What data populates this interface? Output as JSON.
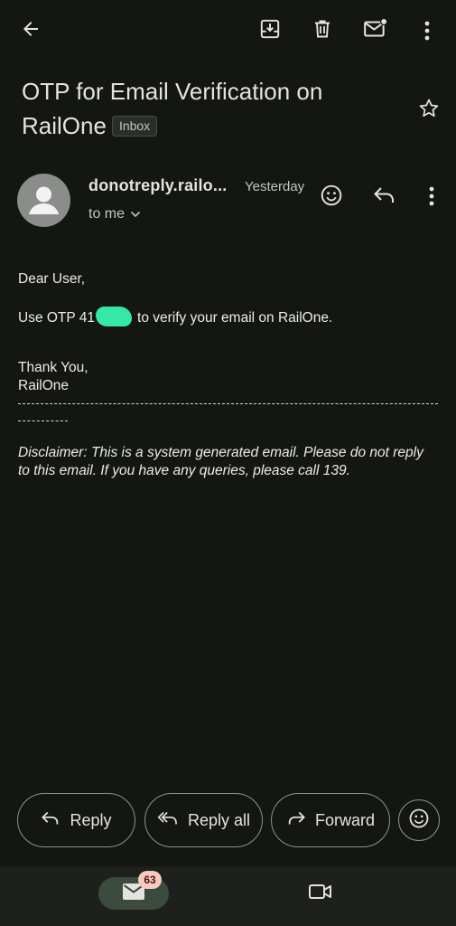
{
  "header": {
    "subject": "OTP for Email Verification on RailOne",
    "label": "Inbox"
  },
  "message": {
    "sender": "donotreply.railo...",
    "time": "Yesterday",
    "recipient": "to me"
  },
  "body": {
    "greeting": "Dear User,",
    "otp_prefix": "Use OTP 41",
    "otp_suffix": "to verify your email on RailOne.",
    "thanks": "Thank You,",
    "signature": "RailOne",
    "disclaimer": "Disclaimer: This is a system generated email. Please do not reply to this email. If you have any queries, please call 139."
  },
  "actions": {
    "reply_label": "Reply",
    "reply_all_label": "Reply all",
    "forward_label": "Forward"
  },
  "bottom_nav": {
    "mail_badge": "63"
  },
  "icons": {
    "top_bar": [
      "back-arrow-icon",
      "archive-icon",
      "delete-icon",
      "mark-unread-icon",
      "more-vert-icon"
    ],
    "star": "star-icon",
    "message_actions": [
      "emoji-icon",
      "reply-icon",
      "more-vert-icon"
    ],
    "nav": [
      "mail-icon",
      "video-camera-icon"
    ]
  },
  "colors": {
    "background": "#141614",
    "redaction": "#35e8a6",
    "badge": "#f7c9c1",
    "nav_active_pill": "#3b4b3d"
  }
}
